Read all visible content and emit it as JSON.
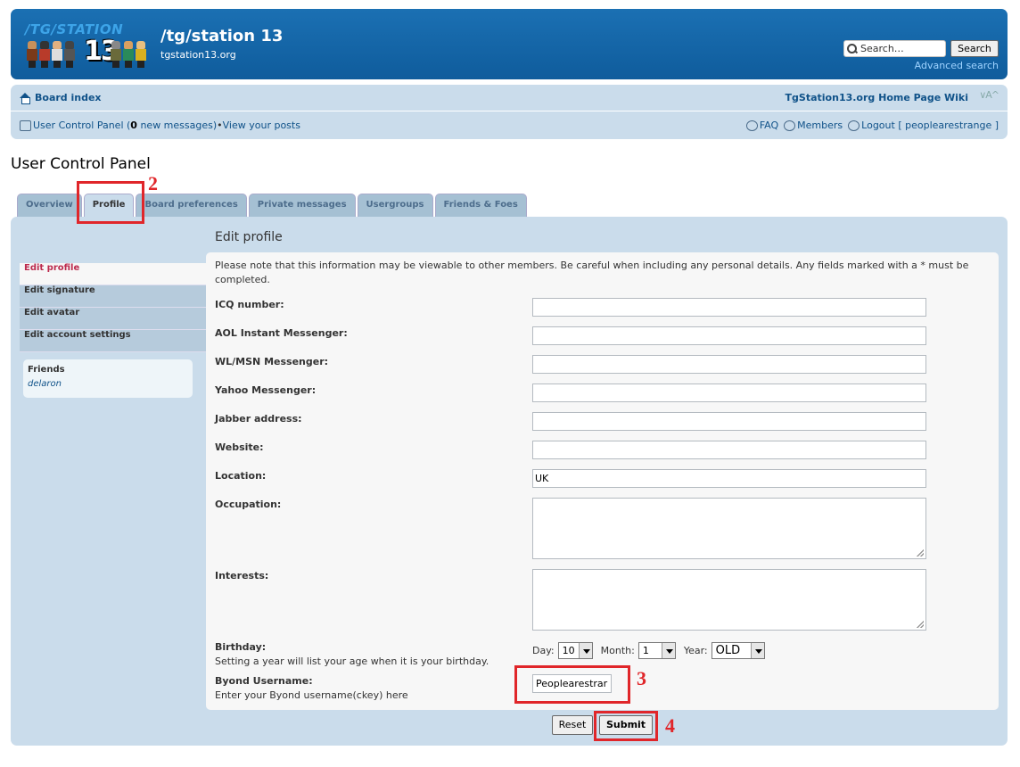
{
  "header": {
    "logo_text": "/TG/STATION",
    "logo_number": "13",
    "site_title": "/tg/station 13",
    "site_subtitle": "tgstation13.org",
    "search_placeholder": "Search…",
    "search_button": "Search",
    "advanced_search": "Advanced search"
  },
  "navbar": {
    "board_index": "Board index",
    "home_page": "TgStation13.org Home Page",
    "wiki": "Wiki",
    "font_controls": "∨A^",
    "ucp_prefix": "User Control Panel (",
    "new_messages_count": "0",
    "ucp_suffix": " new messages)",
    "separator": " • ",
    "view_posts": "View your posts",
    "faq": "FAQ",
    "members": "Members",
    "logout": "Logout [ peoplearestrange ]"
  },
  "page": {
    "title": "User Control Panel",
    "tabs": [
      "Overview",
      "Profile",
      "Board preferences",
      "Private messages",
      "Usergroups",
      "Friends & Foes"
    ]
  },
  "sidebar": {
    "items": [
      "Edit profile",
      "Edit signature",
      "Edit avatar",
      "Edit account settings"
    ],
    "friends_title": "Friends",
    "friends": [
      "delaron"
    ]
  },
  "form": {
    "title": "Edit profile",
    "notice": "Please note that this information may be viewable to other members. Be careful when including any personal details. Any fields marked with a * must be completed.",
    "fields": [
      {
        "label": "ICQ number:",
        "value": ""
      },
      {
        "label": "AOL Instant Messenger:",
        "value": ""
      },
      {
        "label": "WL/MSN Messenger:",
        "value": ""
      },
      {
        "label": "Yahoo Messenger:",
        "value": ""
      },
      {
        "label": "Jabber address:",
        "value": ""
      },
      {
        "label": "Website:",
        "value": ""
      },
      {
        "label": "Location:",
        "value": "UK"
      }
    ],
    "occupation_label": "Occupation:",
    "interests_label": "Interests:",
    "birthday_label": "Birthday:",
    "birthday_hint": "Setting a year will list your age when it is your birthday.",
    "day_label": "Day:",
    "day_value": "10",
    "month_label": "Month:",
    "month_value": "1",
    "year_label": "Year:",
    "year_value": "OLD",
    "byond_label": "Byond Username:",
    "byond_hint": "Enter your Byond username(ckey) here",
    "byond_value": "Peoplearestrar",
    "reset_button": "Reset",
    "submit_button": "Submit"
  },
  "annotations": [
    "2",
    "3",
    "4"
  ],
  "colors": {
    "header_blue": "#1b70b3",
    "panel_blue": "#cadceb",
    "annotation_red": "#e0262a"
  }
}
